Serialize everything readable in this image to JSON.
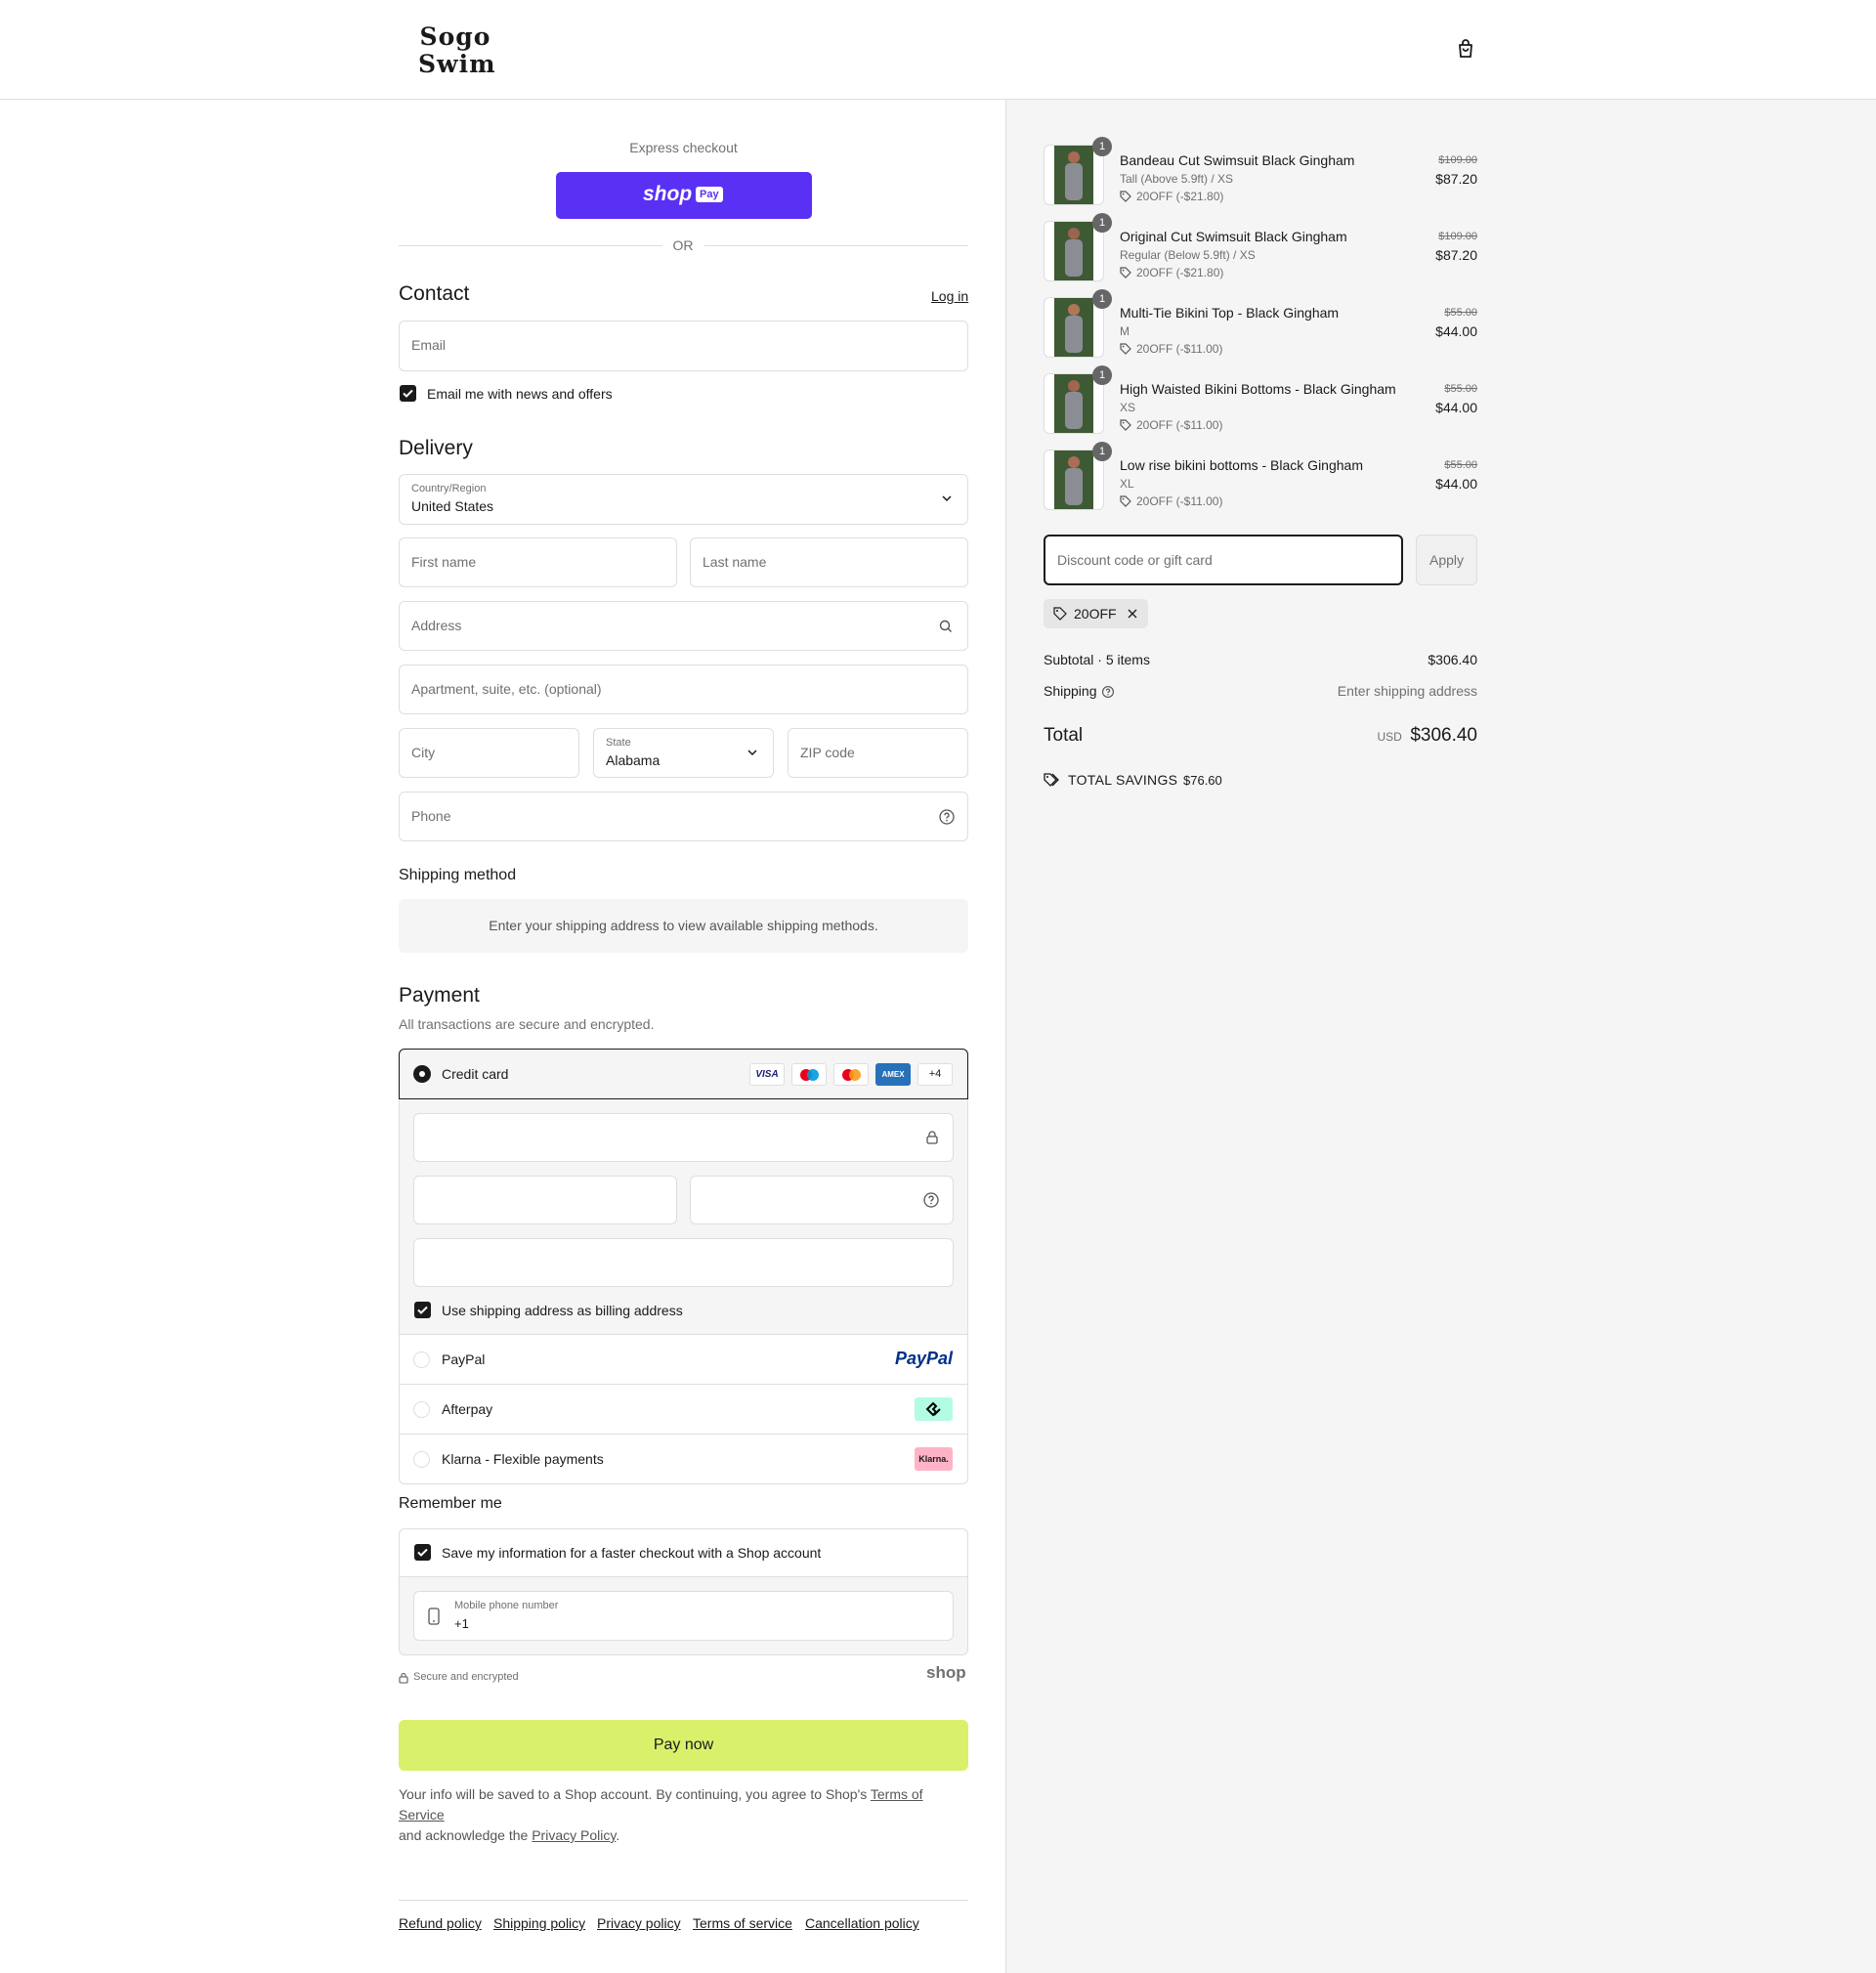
{
  "header": {
    "logo_line1": "Sogo",
    "logo_line2": "Swim"
  },
  "express": {
    "label": "Express checkout",
    "shop_pay_word": "shop",
    "shop_pay_badge": "Pay",
    "or": "OR"
  },
  "contact": {
    "title": "Contact",
    "login": "Log in",
    "email_placeholder": "Email",
    "newsletter_label": "Email me with news and offers",
    "newsletter_checked": true
  },
  "delivery": {
    "title": "Delivery",
    "country_label": "Country/Region",
    "country_value": "United States",
    "first_name_placeholder": "First name",
    "last_name_placeholder": "Last name",
    "address_placeholder": "Address",
    "apartment_placeholder": "Apartment, suite, etc. (optional)",
    "city_placeholder": "City",
    "state_label": "State",
    "state_value": "Alabama",
    "zip_placeholder": "ZIP code",
    "phone_placeholder": "Phone"
  },
  "shipping_method": {
    "title": "Shipping method",
    "notice": "Enter your shipping address to view available shipping methods."
  },
  "payment": {
    "title": "Payment",
    "subtitle": "All transactions are secure and encrypted.",
    "credit_card_label": "Credit card",
    "card_brands": [
      "VISA",
      "Maestro",
      "Mastercard",
      "AMEX"
    ],
    "more_brands": "+4",
    "billing_same_label": "Use shipping address as billing address",
    "paypal_label": "PayPal",
    "paypal_logo": "PayPal",
    "afterpay_label": "Afterpay",
    "klarna_label": "Klarna - Flexible payments",
    "klarna_logo": "Klarna."
  },
  "remember": {
    "title": "Remember me",
    "save_label": "Save my information for a faster checkout with a Shop account",
    "mobile_label": "Mobile phone number",
    "mobile_value": "+1",
    "secure_label": "Secure and encrypted",
    "shop_logo": "shop"
  },
  "pay_button": "Pay now",
  "legal": {
    "text1": "Your info will be saved to a Shop account. By continuing, you agree to Shop's ",
    "tos": "Terms of Service",
    "text2": "and acknowledge the ",
    "privacy": "Privacy Policy",
    "text3": "."
  },
  "footer_links": [
    "Refund policy",
    "Shipping policy",
    "Privacy policy",
    "Terms of service",
    "Cancellation policy"
  ],
  "order": {
    "items": [
      {
        "qty": "1",
        "name": "Bandeau Cut Swimsuit Black Gingham",
        "variant": "Tall (Above 5.9ft) / XS",
        "discount": "20OFF (-$21.80)",
        "original": "$109.00",
        "price": "$87.20"
      },
      {
        "qty": "1",
        "name": "Original Cut Swimsuit Black Gingham",
        "variant": "Regular (Below 5.9ft) / XS",
        "discount": "20OFF (-$21.80)",
        "original": "$109.00",
        "price": "$87.20"
      },
      {
        "qty": "1",
        "name": "Multi-Tie Bikini Top - Black Gingham",
        "variant": "M",
        "discount": "20OFF (-$11.00)",
        "original": "$55.00",
        "price": "$44.00"
      },
      {
        "qty": "1",
        "name": "High Waisted Bikini Bottoms - Black Gingham",
        "variant": "XS",
        "discount": "20OFF (-$11.00)",
        "original": "$55.00",
        "price": "$44.00"
      },
      {
        "qty": "1",
        "name": "Low rise bikini bottoms - Black Gingham",
        "variant": "XL",
        "discount": "20OFF (-$11.00)",
        "original": "$55.00",
        "price": "$44.00"
      }
    ],
    "discount_placeholder": "Discount code or gift card",
    "apply": "Apply",
    "applied_code": "20OFF",
    "subtotal_label": "Subtotal · 5 items",
    "subtotal_value": "$306.40",
    "shipping_label": "Shipping",
    "shipping_value": "Enter shipping address",
    "total_label": "Total",
    "currency": "USD",
    "total_value": "$306.40",
    "savings_label": "TOTAL SAVINGS",
    "savings_value": "$76.60"
  },
  "colors": {
    "shop_pay": "#5a31f4",
    "pay_now": "#d9f06b",
    "afterpay": "#b2fce4",
    "klarna": "#ffb3c7",
    "paypal_dark": "#003087",
    "paypal_light": "#009cde"
  }
}
